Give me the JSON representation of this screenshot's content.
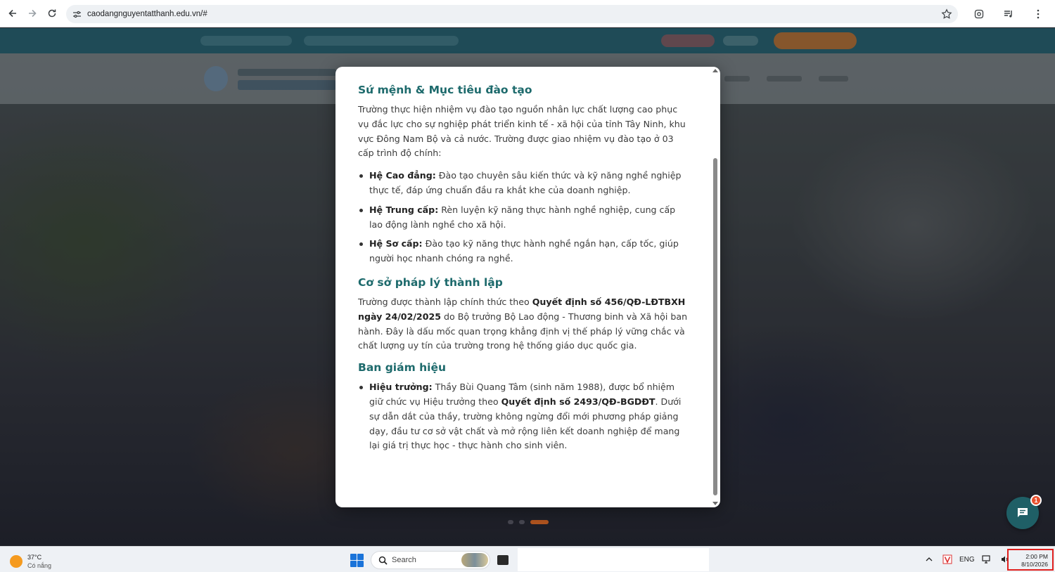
{
  "browser": {
    "url": "caodangnguyentatthanh.edu.vn/#"
  },
  "modal": {
    "section1": {
      "title": "Sứ mệnh & Mục tiêu đào tạo",
      "intro": "Trường thực hiện nhiệm vụ đào tạo nguồn nhân lực chất lượng cao phục vụ đắc lực cho sự nghiệp phát triển kinh tế - xã hội của tỉnh Tây Ninh, khu vực Đông Nam Bộ và cả nước. Trường được giao nhiệm vụ đào tạo ở 03 cấp trình độ chính:",
      "items": [
        {
          "label": "Hệ Cao đẳng:",
          "text": " Đào tạo chuyên sâu kiến thức và kỹ năng nghề nghiệp thực tế, đáp ứng chuẩn đầu ra khắt khe của doanh nghiệp."
        },
        {
          "label": "Hệ Trung cấp:",
          "text": " Rèn luyện kỹ năng thực hành nghề nghiệp, cung cấp lao động lành nghề cho xã hội."
        },
        {
          "label": "Hệ Sơ cấp:",
          "text": " Đào tạo kỹ năng thực hành nghề ngắn hạn, cấp tốc, giúp người học nhanh chóng ra nghề."
        }
      ]
    },
    "section2": {
      "title": "Cơ sở pháp lý thành lập",
      "pre": "Trường được thành lập chính thức theo ",
      "bold": "Quyết định số 456/QĐ-LĐTBXH ngày 24/02/2025",
      "post": " do Bộ trưởng Bộ Lao động - Thương binh và Xã hội ban hành. Đây là dấu mốc quan trọng khẳng định vị thế pháp lý vững chắc và chất lượng uy tín của trường trong hệ thống giáo dục quốc gia."
    },
    "section3": {
      "title": "Ban giám hiệu",
      "label": "Hiệu trưởng:",
      "pre": " Thầy Bùi Quang Tâm (sinh năm 1988), được bổ nhiệm giữ chức vụ Hiệu trưởng theo ",
      "bold": "Quyết định số 2493/QĐ-BGDĐT",
      "post": ". Dưới sự dẫn dắt của thầy, trường không ngừng đổi mới phương pháp giảng dạy, đầu tư cơ sở vật chất và mở rộng liên kết doanh nghiệp để mang lại giá trị thực học - thực hành cho sinh viên."
    }
  },
  "chat": {
    "badge": "1"
  },
  "taskbar": {
    "weather_temp": "37°C",
    "weather_cond": "Có nắng",
    "search_label": "Search",
    "lang": "ENG",
    "time": "2:00 PM",
    "date": "8/10/2026"
  },
  "colors": {
    "accent": "#1d6a6c",
    "chat": "#1f5f66",
    "badge": "#e8502e",
    "highlight_border": "#e0201e"
  }
}
